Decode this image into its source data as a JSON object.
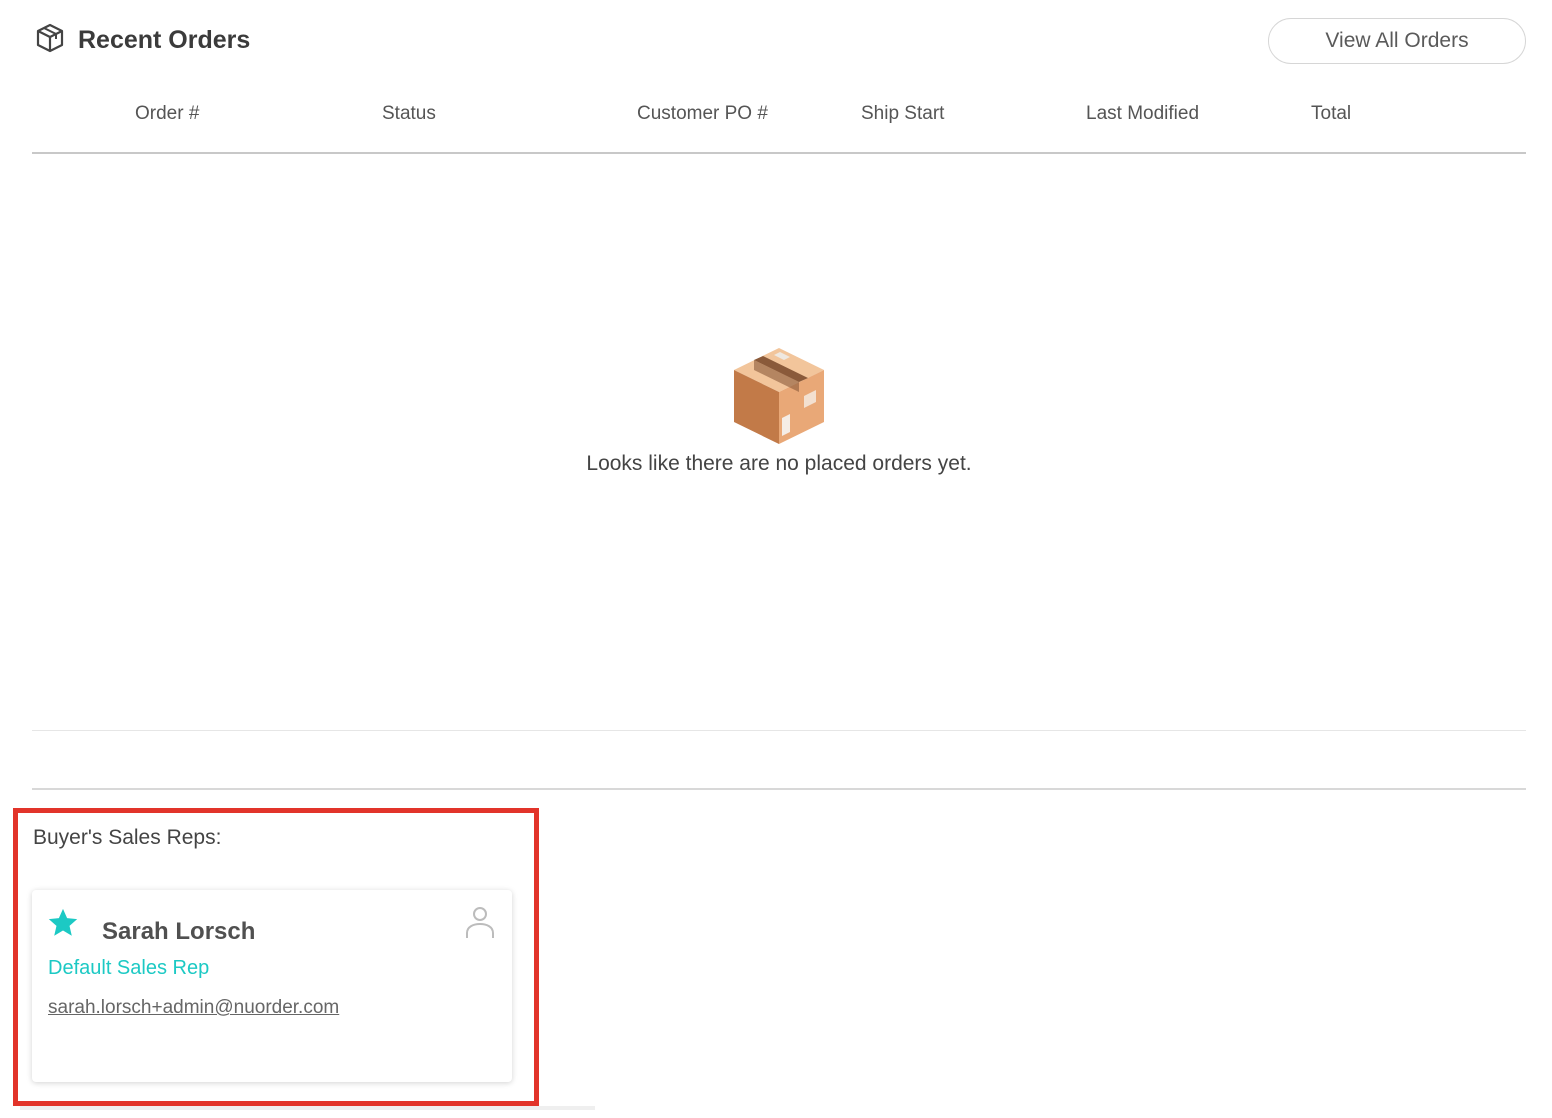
{
  "header": {
    "title": "Recent Orders",
    "title_icon": "package-outline-icon",
    "view_all_label": "View All Orders"
  },
  "table": {
    "columns": [
      "Order #",
      "Status",
      "Customer PO #",
      "Ship Start",
      "Last Modified",
      "Total"
    ]
  },
  "empty_state": {
    "icon": "cardboard-box-icon",
    "message": "Looks like there are no placed orders yet."
  },
  "sales_reps": {
    "title": "Buyer's Sales Reps:",
    "reps": [
      {
        "name": "Sarah Lorsch",
        "role": "Default Sales Rep",
        "email": "sarah.lorsch+admin@nuorder.com",
        "star_icon": "star-icon",
        "avatar_icon": "person-outline-icon"
      }
    ]
  },
  "colors": {
    "accent": "#1cc9c4",
    "highlight_border": "#e2342a",
    "box_dark": "#c57f4f",
    "box_light": "#e8a87a"
  }
}
